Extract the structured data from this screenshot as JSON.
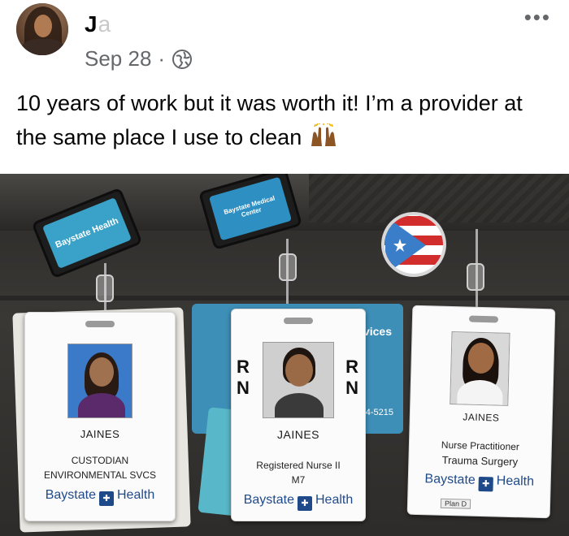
{
  "post": {
    "author_visible": "J",
    "author_faded": "a",
    "date": "Sep 28",
    "separator": "·",
    "privacy_icon": "globe-icon",
    "more_label": "•••",
    "caption": "10 years of work but it was worth it! I’m a provider at the same place I use to clean",
    "caption_emoji": "raising-hands-icon"
  },
  "photo": {
    "reel_left_label": "Baystate Health",
    "reel_center_label": "Baystate Medical Center",
    "back_card_text": "vices",
    "back_card_phone": "74-5215",
    "badges": [
      {
        "name": "JAINES",
        "role_line1": "CUSTODIAN",
        "role_line2": "ENVIRONMENTAL SVCS",
        "logo_left": "Baystate",
        "logo_right": "Health"
      },
      {
        "name": "JAINES",
        "rn_left_top": "R",
        "rn_left_bottom": "N",
        "rn_right_top": "R",
        "rn_right_bottom": "N",
        "role_line1": "Registered Nurse II",
        "role_line2": "M7",
        "logo_left": "Baystate",
        "logo_right": "Health"
      },
      {
        "name": "JAINES",
        "role_line1": "Nurse Practitioner",
        "role_line2": "Trauma Surgery",
        "logo_left": "Baystate",
        "logo_right": "Health",
        "footer_text": "Plan D"
      }
    ]
  },
  "colors": {
    "brand_blue": "#1f4a8a",
    "meta_gray": "#65676b"
  }
}
